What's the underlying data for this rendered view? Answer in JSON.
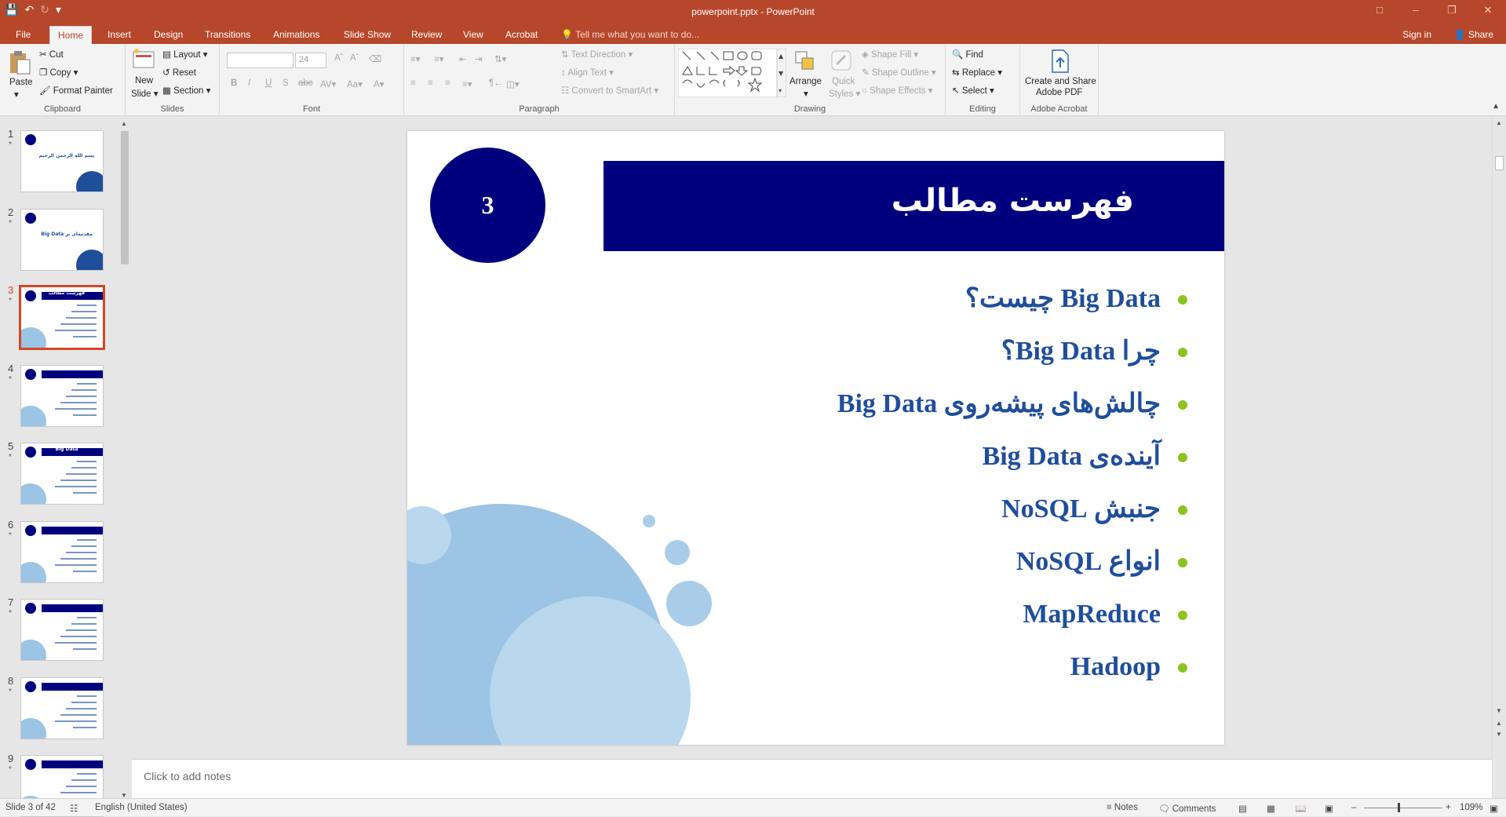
{
  "titlebar": {
    "document_title": "powerpoint.pptx - PowerPoint",
    "qat_icons": [
      "save-icon",
      "undo-icon",
      "redo-icon",
      "customize-icon"
    ]
  },
  "tabs": [
    "File",
    "Home",
    "Insert",
    "Design",
    "Transitions",
    "Animations",
    "Slide Show",
    "Review",
    "View",
    "Acrobat"
  ],
  "active_tab": "Home",
  "tell_me": "Tell me what you want to do...",
  "account": {
    "sign_in": "Sign in",
    "share": "Share"
  },
  "ribbon": {
    "clipboard": {
      "paste": "Paste",
      "cut": "Cut",
      "copy": "Copy",
      "format_painter": "Format Painter",
      "group": "Clipboard"
    },
    "slides": {
      "new_slide_1": "New",
      "new_slide_2": "Slide",
      "layout": "Layout",
      "reset": "Reset",
      "section": "Section",
      "group": "Slides"
    },
    "font": {
      "font_name": "",
      "font_size": "24",
      "group": "Font"
    },
    "paragraph": {
      "text_direction": "Text Direction",
      "align_text": "Align Text",
      "convert_smartart": "Convert to SmartArt",
      "group": "Paragraph"
    },
    "drawing": {
      "arrange": "Arrange",
      "quick_styles_1": "Quick",
      "quick_styles_2": "Styles",
      "shape_fill": "Shape Fill",
      "shape_outline": "Shape Outline",
      "shape_effects": "Shape Effects",
      "group": "Drawing"
    },
    "editing": {
      "find": "Find",
      "replace": "Replace",
      "select": "Select",
      "group": "Editing"
    },
    "acrobat": {
      "create_1": "Create and Share",
      "create_2": "Adobe PDF",
      "group": "Adobe Acrobat"
    }
  },
  "thumbnails": [
    {
      "num": "1",
      "star": "*",
      "text": "بسم الله الرحمن الرحيم"
    },
    {
      "num": "2",
      "star": "*",
      "text": "مقدمه‌ای بر Big Data"
    },
    {
      "num": "3",
      "star": "*",
      "text": "فهرست مطالب"
    },
    {
      "num": "4",
      "star": "*",
      "text": ""
    },
    {
      "num": "5",
      "star": "*",
      "text": "Big Data"
    },
    {
      "num": "6",
      "star": "*",
      "text": ""
    },
    {
      "num": "7",
      "star": "*",
      "text": ""
    },
    {
      "num": "8",
      "star": "*",
      "text": ""
    },
    {
      "num": "9",
      "star": "*",
      "text": ""
    }
  ],
  "selected_slide": 3,
  "slide": {
    "number": "3",
    "title": "فهرست مطالب",
    "bullets": [
      "Big Data چیست؟",
      "چرا Big Data؟",
      "چالش‌های پیشه‌روی Big Data",
      "آینده‌ی Big Data",
      "جنبش NoSQL",
      "انواع NoSQL",
      "MapReduce",
      "Hadoop"
    ],
    "colors": {
      "band": "#00007f",
      "bullet_text": "#1f4e9a",
      "bullet_dot": "#8dc21f",
      "bubble": "#9cc4e4"
    }
  },
  "notes_placeholder": "Click to add notes",
  "status": {
    "slide_of": "Slide 3 of 42",
    "language": "English (United States)",
    "notes": "Notes",
    "comments": "Comments",
    "zoom": "109%"
  }
}
